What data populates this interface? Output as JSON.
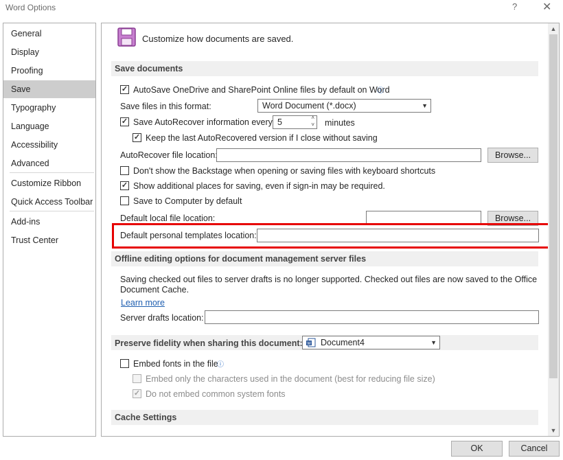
{
  "window": {
    "title": "Word Options",
    "help": "?",
    "close": "✕"
  },
  "nav": {
    "items": [
      "General",
      "Display",
      "Proofing",
      "Save",
      "Typography",
      "Language",
      "Accessibility",
      "Advanced",
      "Customize Ribbon",
      "Quick Access Toolbar",
      "Add-ins",
      "Trust Center"
    ],
    "selected": "Save"
  },
  "header": {
    "text": "Customize how documents are saved."
  },
  "save_documents": {
    "title": "Save documents",
    "autosave_label": "AutoSave OneDrive and SharePoint Online files by default on Word",
    "format_label": "Save files in this format:",
    "format_value": "Word Document (*.docx)",
    "autorecover_label": "Save AutoRecover information every",
    "autorecover_minutes": "5",
    "minutes_label": "minutes",
    "keep_last_label": "Keep the last AutoRecovered version if I close without saving",
    "autorecover_location_label": "AutoRecover file location:",
    "browse1": "Browse...",
    "backstage_label": "Don't show the Backstage when opening or saving files with keyboard shortcuts",
    "additional_places_label": "Show additional places for saving, even if sign-in may be required.",
    "save_computer_label": "Save to Computer by default",
    "default_local_label": "Default local file location:",
    "browse2": "Browse...",
    "templates_label": "Default personal templates location:"
  },
  "offline": {
    "title": "Offline editing options for document management server files",
    "notice_line1": "Saving checked out files to server drafts is no longer supported. Checked out files are now saved to the Office",
    "notice_line2": "Document Cache.",
    "learn_more": "Learn more",
    "drafts_label": "Server drafts location:"
  },
  "fidelity": {
    "title": "Preserve fidelity when sharing this document:",
    "document": "Document4",
    "embed_fonts_label": "Embed fonts in the file",
    "embed_only_label": "Embed only the characters used in the document (best for reducing file size)",
    "no_common_label": "Do not embed common system fonts"
  },
  "cache": {
    "title": "Cache Settings"
  },
  "footer": {
    "ok": "OK",
    "cancel": "Cancel"
  }
}
